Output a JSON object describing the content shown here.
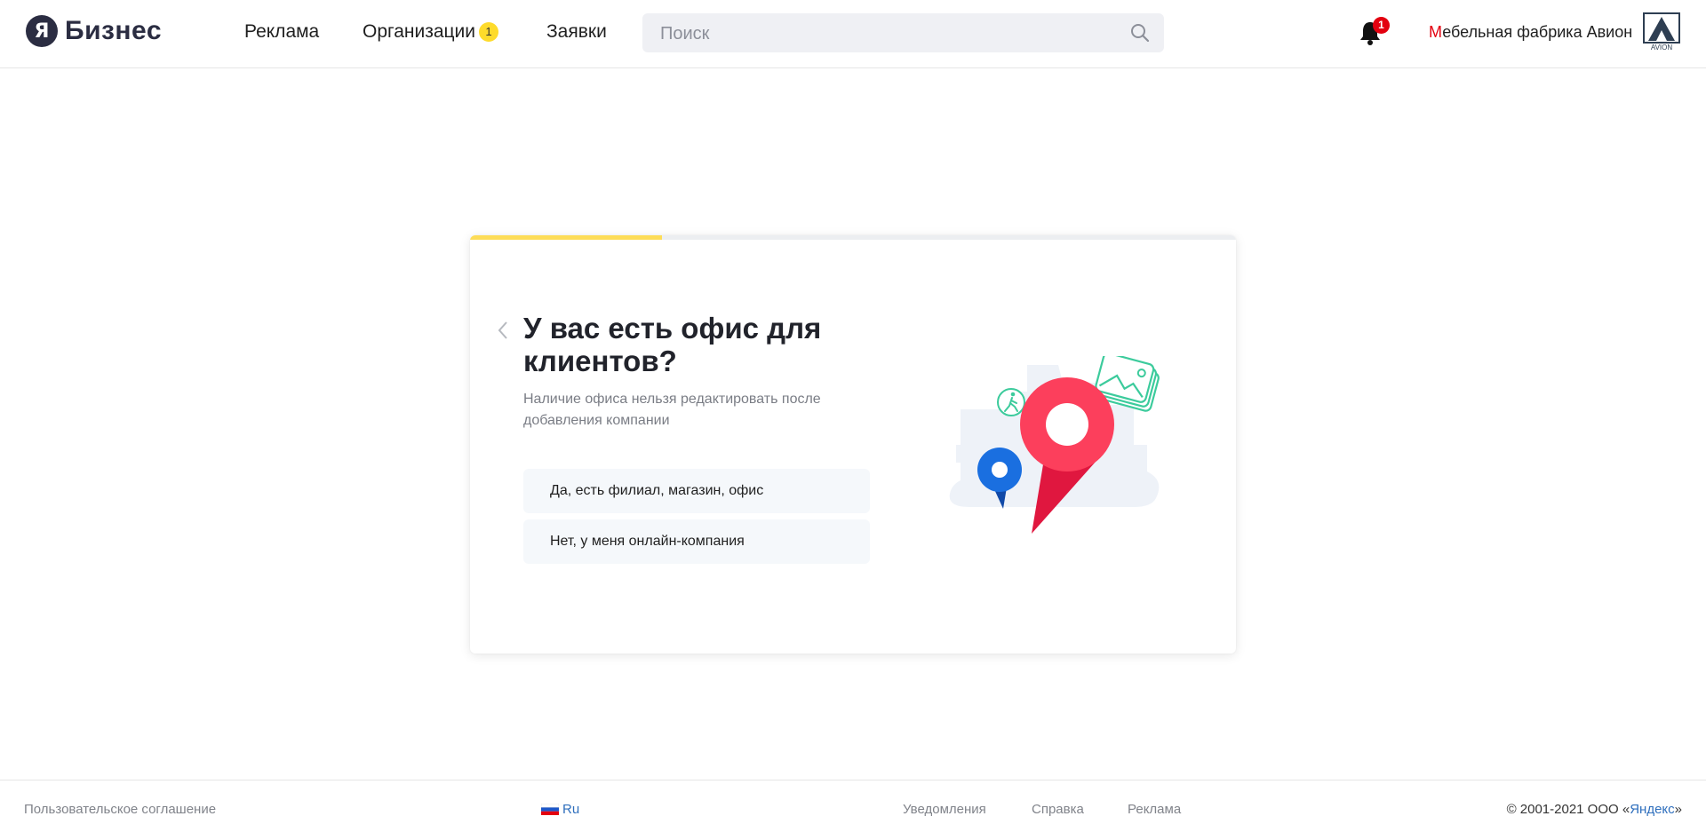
{
  "header": {
    "logo_letter": "Я",
    "logo_text": "Бизнес",
    "nav": [
      {
        "label": "Реклама"
      },
      {
        "label": "Организации",
        "badge": "1"
      },
      {
        "label": "Заявки"
      }
    ],
    "search_placeholder": "Поиск",
    "notifications_count": "1",
    "user_name_first": "М",
    "user_name_rest": "ебельная фабрика Авион",
    "avatar_text": "AVION"
  },
  "wizard": {
    "progress": 0.25,
    "title": "У вас есть офис для клиентов?",
    "subtitle": "Наличие офиса нельзя редактировать после добавления компании",
    "options": [
      {
        "label": "Да, есть филиал, магазин, офис"
      },
      {
        "label": "Нет, у меня онлайн-компания"
      }
    ]
  },
  "footer": {
    "agreement": "Пользовательское соглашение",
    "language": "Ru",
    "links": [
      {
        "label": "Уведомления"
      },
      {
        "label": "Справка"
      },
      {
        "label": "Реклама"
      }
    ],
    "copyright_prefix": "© 2001-2021  ООО «",
    "copyright_company": "Яндекс",
    "copyright_suffix": "»"
  },
  "colors": {
    "accent_yellow": "#fddc57",
    "badge_red": "#e3000f",
    "pin_red": "#fc3f5c",
    "pin_blue": "#1a6fe0",
    "illustration_green": "#3ccb9c"
  }
}
